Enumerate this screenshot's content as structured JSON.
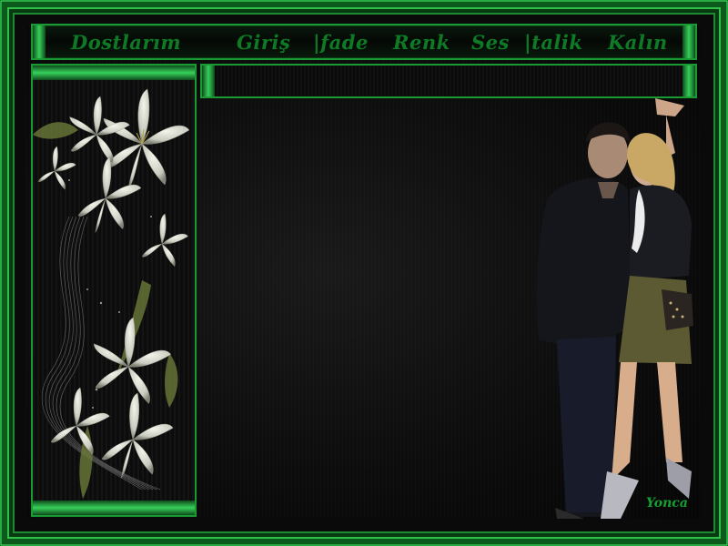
{
  "nav": {
    "items": [
      {
        "label": "Dostlarım"
      },
      {
        "label": "Giriş"
      },
      {
        "label": "|fade"
      },
      {
        "label": "Renk"
      },
      {
        "label": "Ses"
      },
      {
        "label": "|talik"
      },
      {
        "label": "Kalın"
      }
    ]
  },
  "signature": "Yonca",
  "colors": {
    "frame_green": "#1a9a33",
    "nav_text": "#0f7a26",
    "background": "#0a0a0a"
  },
  "images": {
    "sidebar": "white-lilies-decoration",
    "main": "couple-photo"
  }
}
